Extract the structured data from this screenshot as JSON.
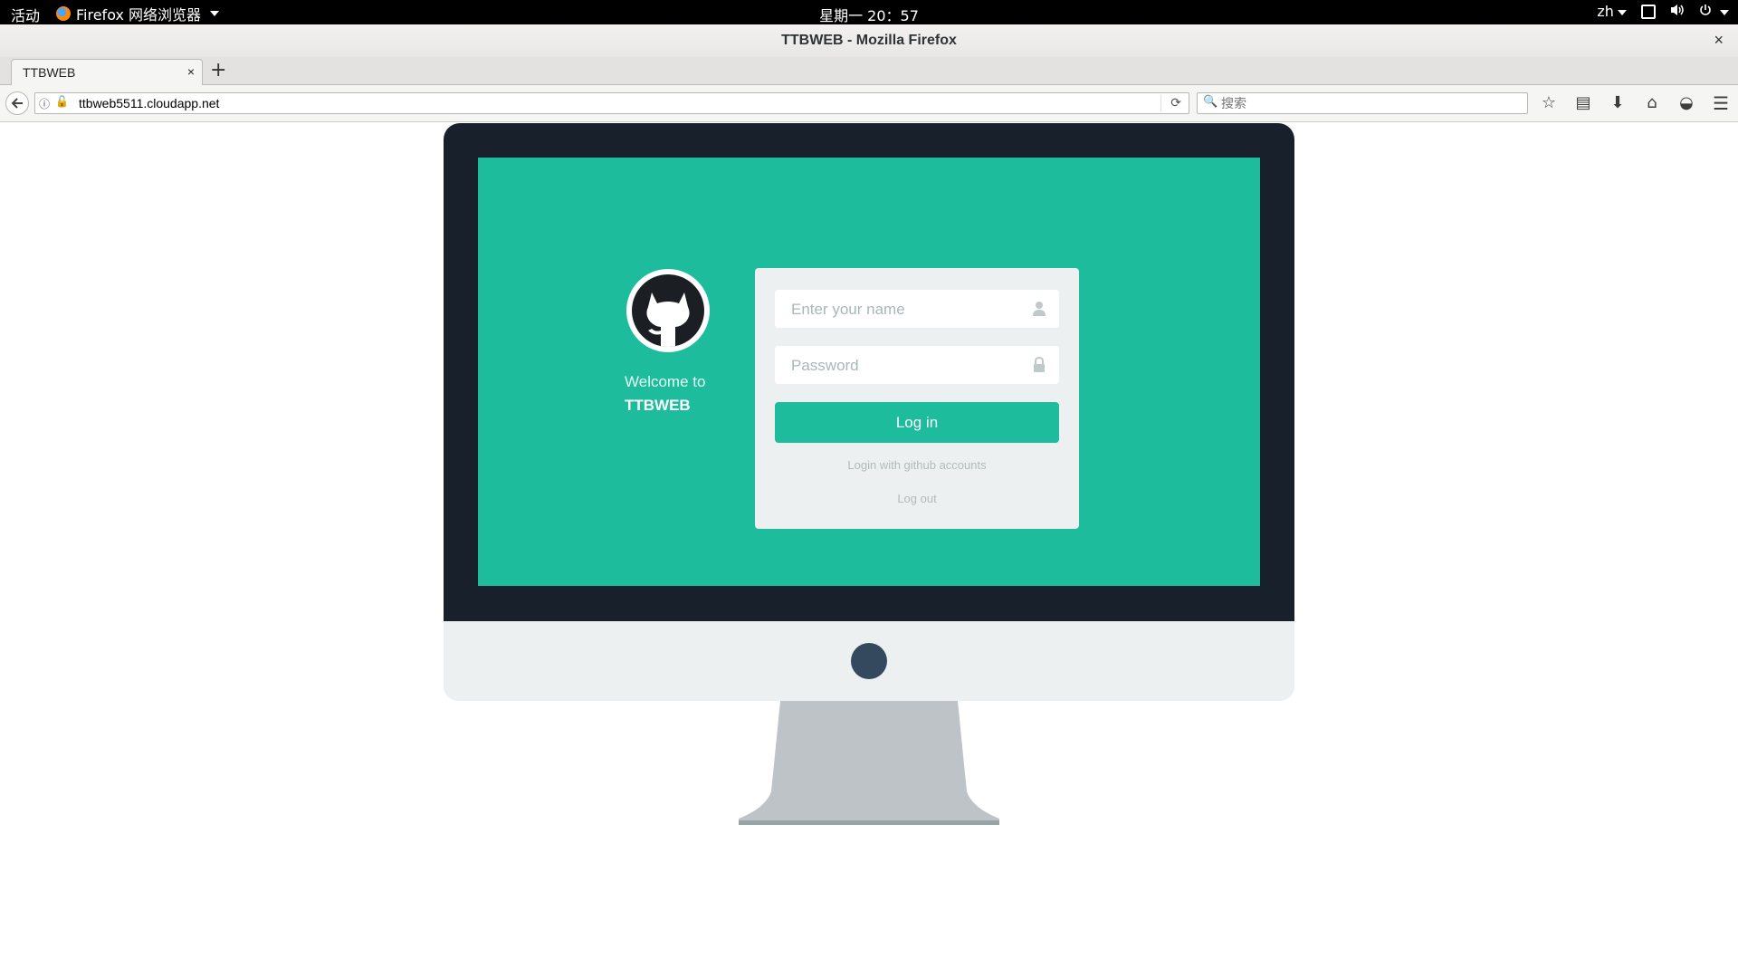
{
  "system_bar": {
    "activities": "活动",
    "app_menu": "Firefox 网络浏览器",
    "clock": "星期一 20：57",
    "language": "zh"
  },
  "window": {
    "title": "TTBWEB - Mozilla Firefox",
    "close": "×"
  },
  "tabs": [
    {
      "label": "TTBWEB",
      "close": "×"
    }
  ],
  "new_tab": "+",
  "navbar": {
    "url": "ttbweb5511.cloudapp.net",
    "search_placeholder": "搜索"
  },
  "page": {
    "welcome_line1": "Welcome to",
    "welcome_line2": "TTBWEB",
    "name_placeholder": "Enter your name",
    "password_placeholder": "Password",
    "login_button": "Log in",
    "github_link": "Login with github accounts",
    "logout_link": "Log out"
  },
  "colors": {
    "screen": "#1cbc9c",
    "bezel": "#17202b",
    "chin": "#ecf0f1",
    "stand": "#bdc3c7"
  }
}
